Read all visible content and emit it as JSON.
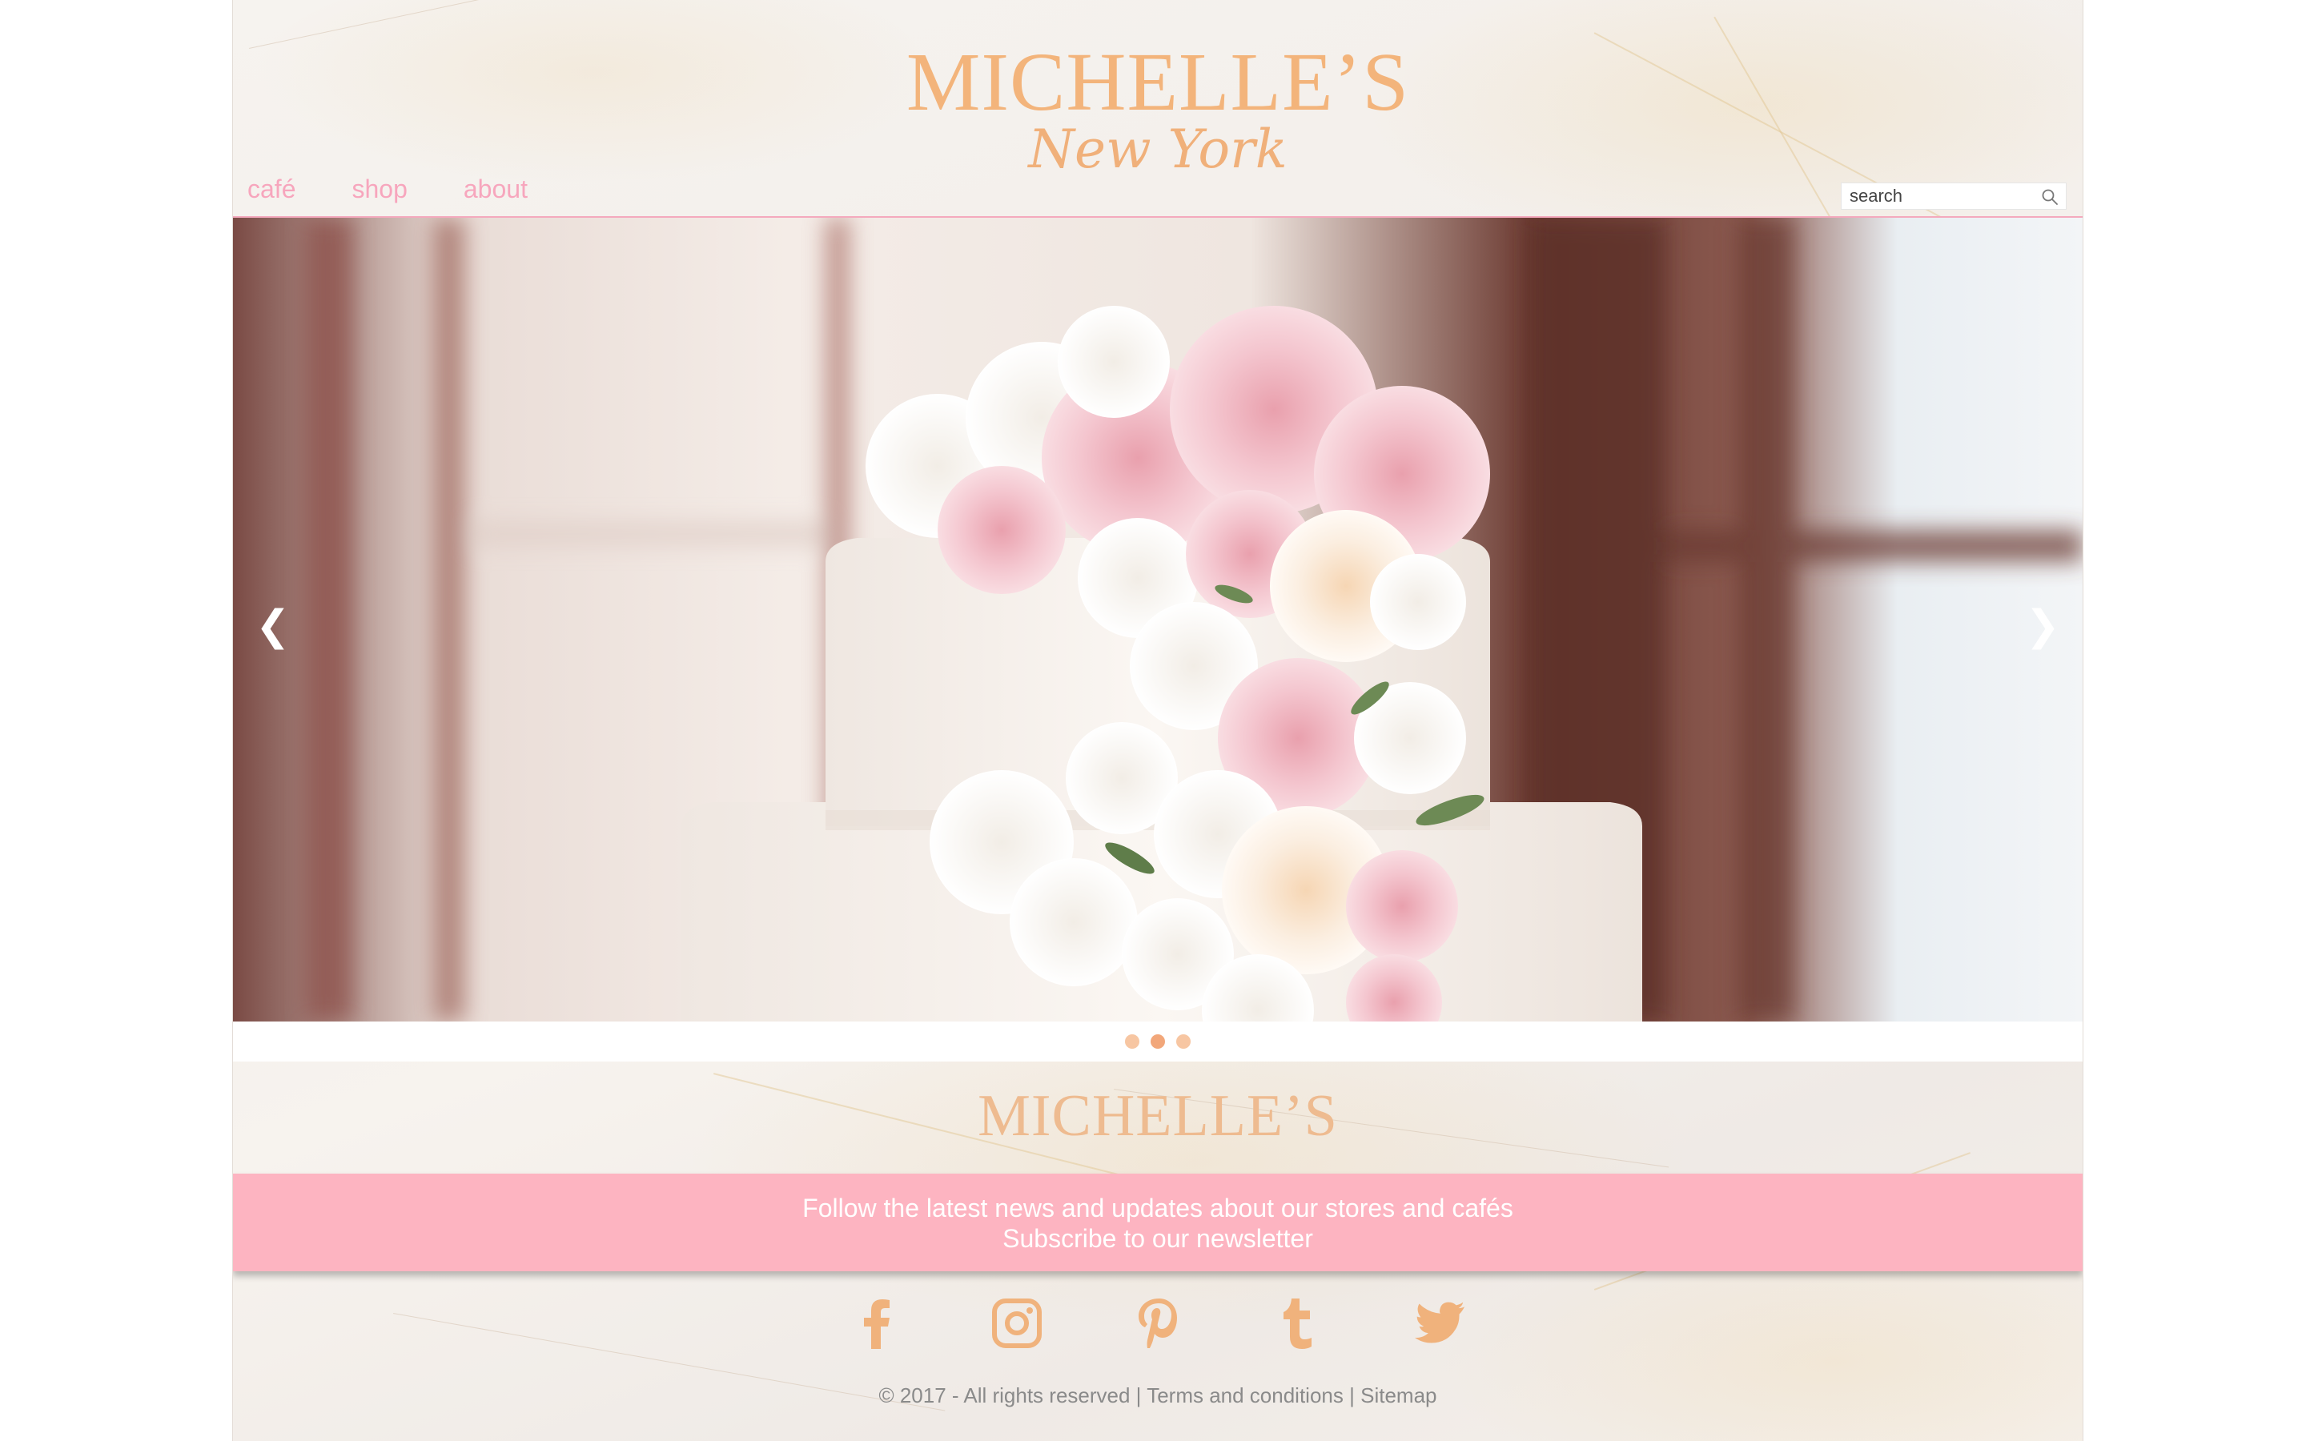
{
  "header": {
    "logo_main": "MICHELLE’S",
    "logo_sub": "New York",
    "nav": [
      {
        "label": "café"
      },
      {
        "label": "shop"
      },
      {
        "label": "about"
      }
    ],
    "search": {
      "placeholder": "search",
      "icon": "search-icon"
    }
  },
  "carousel": {
    "prev_icon": "chevron-left-icon",
    "next_icon": "chevron-right-icon",
    "prev_glyph": "❮",
    "next_glyph": "❯",
    "slide_count": 3,
    "active_index": 1,
    "slide_description_alt": "Tiered white wedding cake with pink and cream flowers"
  },
  "footer": {
    "logo": "MICHELLE’S",
    "newsletter": {
      "line1": "Follow the latest news and updates about our stores and cafés",
      "line2": "Subscribe to our newsletter"
    },
    "social": [
      "facebook-icon",
      "instagram-icon",
      "pinterest-icon",
      "tumblr-icon",
      "twitter-icon"
    ],
    "copyright": "© 2017 - All rights reserved",
    "links": [
      {
        "label": "Terms and conditions"
      },
      {
        "label": "Sitemap"
      }
    ],
    "separator": "|"
  },
  "colors": {
    "accent_peach": "#f3b47b",
    "accent_pink": "#f7a6bd",
    "banner_pink": "#fdb4c1",
    "text_gray": "#8a8a8a"
  }
}
